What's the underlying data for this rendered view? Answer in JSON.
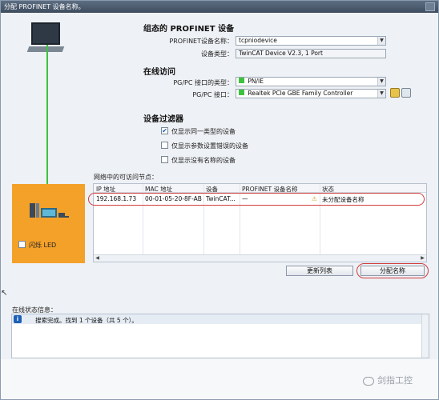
{
  "window": {
    "title": "分配 PROFINET 设备名称。"
  },
  "configured_device": {
    "section_title": "组态的 PROFINET 设备",
    "name_label": "PROFINET设备名称：",
    "name_value": "tcpniodevice",
    "type_label": "设备类型：",
    "type_value": "TwinCAT Device V2.3, 1 Port"
  },
  "online_access": {
    "section_title": "在线访问",
    "interface_type_label": "PG/PC 接口的类型：",
    "interface_type_value": "PN/IE",
    "interface_label": "PG/PC 接口：",
    "interface_value": "Realtek PCIe GBE Family Controller"
  },
  "device_filter": {
    "section_title": "设备过滤器",
    "options": [
      {
        "label": "仅显示同一类型的设备",
        "checked": true
      },
      {
        "label": "仅显示参数设置错误的设备",
        "checked": false
      },
      {
        "label": "仅显示没有名称的设备",
        "checked": false
      }
    ]
  },
  "network": {
    "label": "网络中的可访问节点：",
    "columns": [
      "IP 地址",
      "MAC 地址",
      "设备",
      "PROFINET 设备名称",
      "状态"
    ],
    "rows": [
      {
        "ip": "192.168.1.73",
        "mac": "00-01-05-20-8F-AB",
        "device": "TwinCAT...",
        "name": "—",
        "status": "未分配设备名称"
      }
    ]
  },
  "device_panel": {
    "led_label": "闪烁 LED"
  },
  "buttons": {
    "refresh": "更新列表",
    "assign": "分配名称"
  },
  "status": {
    "label": "在线状态信息：",
    "messages": [
      "搜索完成。找到 1 个设备（共 5 个）。"
    ]
  },
  "watermark": "剑指工控",
  "colors": {
    "accent_orange": "#f4a12a",
    "highlight_red": "#d23c3c",
    "link_green": "#3ec23e",
    "titlebar": "#3e4c5e"
  }
}
